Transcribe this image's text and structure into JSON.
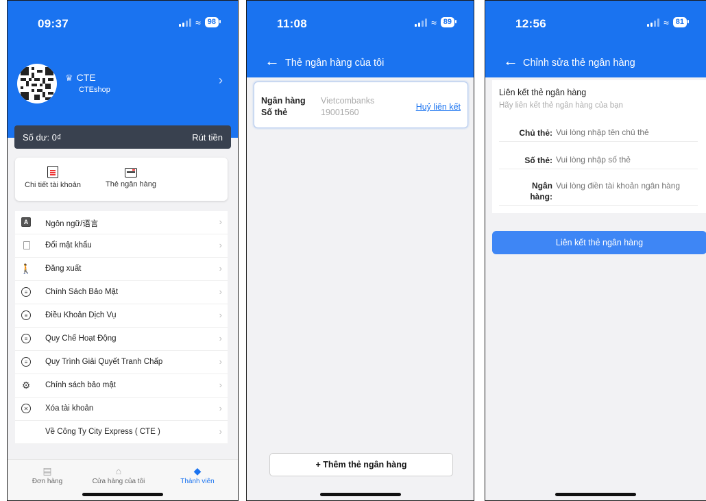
{
  "screen1": {
    "status": {
      "time": "09:37",
      "battery": "98"
    },
    "profile": {
      "name": "CTE",
      "shop": "CTEshop"
    },
    "balance": {
      "label": "Số dư: 0₫",
      "withdraw": "Rút tiền"
    },
    "quick_actions": [
      {
        "label": "Chi tiết tài khoản",
        "icon": "account-detail-icon"
      },
      {
        "label": "Thẻ ngân hàng",
        "icon": "bank-card-icon"
      }
    ],
    "menu": [
      {
        "label": "Ngôn ngữ/语言",
        "icon": "language-icon"
      },
      {
        "label": "Đổi mật khẩu",
        "icon": "password-icon"
      },
      {
        "label": "Đăng xuất",
        "icon": "logout-icon"
      },
      {
        "label": "Chính Sách Bảo Mật",
        "icon": "list-icon"
      },
      {
        "label": "Điều Khoản Dịch Vụ",
        "icon": "list-icon"
      },
      {
        "label": "Quy Chế Hoạt Động",
        "icon": "list-icon"
      },
      {
        "label": "Quy Trình Giải Quyết Tranh Chấp",
        "icon": "list-icon"
      },
      {
        "label": "Chính sách bảo mật",
        "icon": "gear-icon"
      },
      {
        "label": "Xóa tài khoản",
        "icon": "close-circle-icon"
      },
      {
        "label": "Về Công Ty City Express ( CTE )",
        "icon": ""
      }
    ],
    "tabs": [
      {
        "label": "Đơn hàng",
        "icon": "orders-icon"
      },
      {
        "label": "Cửa hàng của tôi",
        "icon": "home-icon"
      },
      {
        "label": "Thành viên",
        "icon": "diamond-icon"
      }
    ]
  },
  "screen2": {
    "status": {
      "time": "11:08",
      "battery": "89"
    },
    "title": "Thẻ ngân hàng của tôi",
    "card": {
      "bank_label": "Ngân hàng",
      "bank_value": "Vietcombanks",
      "number_label": "Số thẻ",
      "number_value": "19001560",
      "unlink": "Huỷ liên kết"
    },
    "add_button": "+ Thêm thẻ ngân hàng"
  },
  "screen3": {
    "status": {
      "time": "12:56",
      "battery": "81"
    },
    "title": "Chỉnh sửa thẻ ngân hàng",
    "form": {
      "heading": "Liên kết thẻ ngân hàng",
      "subheading": "Hãy liên kết thẻ ngân hàng của bạn",
      "holder_label": "Chủ thẻ:",
      "holder_placeholder": "Vui lòng nhập tên chủ thẻ",
      "number_label": "Số thẻ:",
      "number_placeholder": "Vui lòng nhập số thẻ",
      "bank_label_1": "Ngân",
      "bank_label_2": "hàng:",
      "bank_placeholder": "Vui lòng điền tài khoản ngân hàng"
    },
    "submit": "Liên kết thẻ ngân hàng"
  },
  "colors": {
    "primary": "#1a73f0",
    "button": "#3e86f5",
    "balance_bar": "#39414f"
  }
}
